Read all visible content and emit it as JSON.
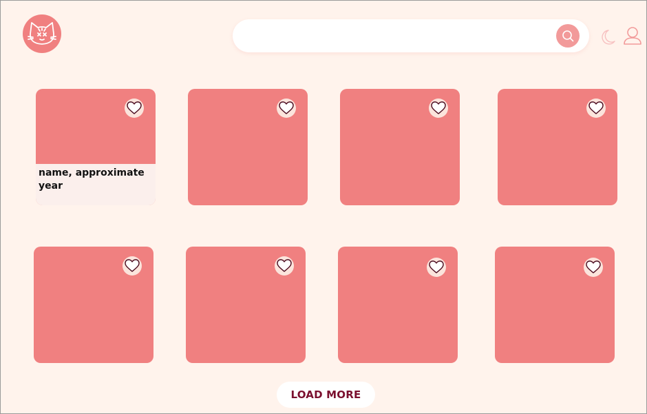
{
  "header": {
    "logo_icon": "cat-face-icon",
    "search": {
      "placeholder": "",
      "value": "",
      "button_icon": "search-icon"
    },
    "theme_toggle_icon": "moon-icon",
    "profile_icon": "user-icon"
  },
  "gallery": {
    "items": [
      {
        "caption": "name, approximate year",
        "favorite_icon": "heart-icon"
      },
      {
        "caption": "",
        "favorite_icon": "heart-icon"
      },
      {
        "caption": "",
        "favorite_icon": "heart-icon"
      },
      {
        "caption": "",
        "favorite_icon": "heart-icon"
      },
      {
        "caption": "",
        "favorite_icon": "heart-icon"
      },
      {
        "caption": "",
        "favorite_icon": "heart-icon"
      },
      {
        "caption": "",
        "favorite_icon": "heart-icon"
      },
      {
        "caption": "",
        "favorite_icon": "heart-icon"
      }
    ]
  },
  "load_more_label": "LOAD MORE",
  "colors": {
    "background": "#fff3ec",
    "card": "#f08080",
    "accent": "#f29a9a",
    "button_text": "#7a0f2e"
  }
}
